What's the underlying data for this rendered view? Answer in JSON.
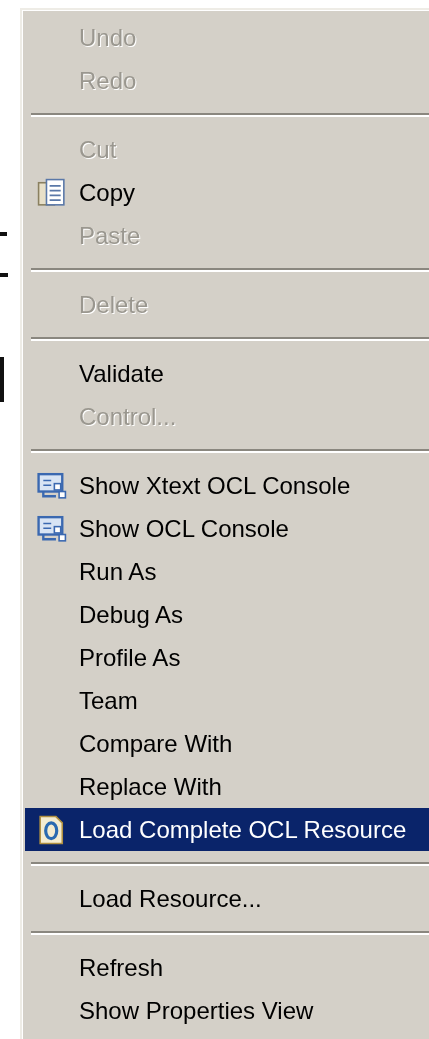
{
  "context_menu": {
    "items": [
      {
        "kind": "item",
        "label": "Undo",
        "disabled": true,
        "selected": false
      },
      {
        "kind": "item",
        "label": "Redo",
        "disabled": true,
        "selected": false
      },
      {
        "kind": "separator"
      },
      {
        "kind": "item",
        "label": "Cut",
        "disabled": true,
        "selected": false
      },
      {
        "kind": "copy-item",
        "label": "Copy",
        "disabled": false,
        "selected": false
      },
      {
        "kind": "item",
        "label": "Paste",
        "disabled": true,
        "selected": false
      },
      {
        "kind": "separator"
      },
      {
        "kind": "item",
        "label": "Delete",
        "disabled": true,
        "selected": false
      },
      {
        "kind": "separator"
      },
      {
        "kind": "item",
        "label": "Validate",
        "disabled": false,
        "selected": false
      },
      {
        "kind": "item",
        "label": "Control...",
        "disabled": true,
        "selected": false
      },
      {
        "kind": "separator"
      },
      {
        "kind": "console-item",
        "label": "Show Xtext OCL Console",
        "disabled": false,
        "selected": false
      },
      {
        "kind": "console-item",
        "label": "Show OCL Console",
        "disabled": false,
        "selected": false
      },
      {
        "kind": "item",
        "label": "Run As",
        "disabled": false,
        "selected": false
      },
      {
        "kind": "item",
        "label": "Debug As",
        "disabled": false,
        "selected": false
      },
      {
        "kind": "item",
        "label": "Profile As",
        "disabled": false,
        "selected": false
      },
      {
        "kind": "item",
        "label": "Team",
        "disabled": false,
        "selected": false
      },
      {
        "kind": "item",
        "label": "Compare With",
        "disabled": false,
        "selected": false
      },
      {
        "kind": "item",
        "label": "Replace With",
        "disabled": false,
        "selected": false
      },
      {
        "kind": "resource-item",
        "label": "Load Complete OCL Resource",
        "disabled": false,
        "selected": true
      },
      {
        "kind": "separator"
      },
      {
        "kind": "item",
        "label": "Load Resource...",
        "disabled": false,
        "selected": false
      },
      {
        "kind": "separator"
      },
      {
        "kind": "item",
        "label": "Refresh",
        "disabled": false,
        "selected": false
      },
      {
        "kind": "item",
        "label": "Show Properties View",
        "disabled": false,
        "selected": false
      }
    ]
  }
}
